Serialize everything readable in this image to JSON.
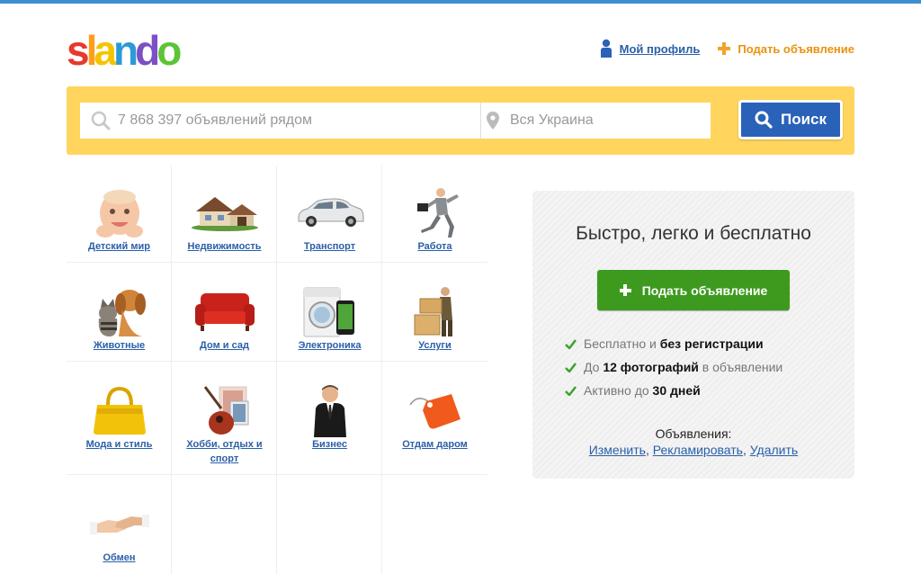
{
  "header": {
    "logo": {
      "letters": [
        "s",
        "l",
        "a",
        "n",
        "d",
        "o"
      ],
      "colors": [
        "#e6392f",
        "#ff9e1b",
        "#f5c400",
        "#2b9bd6",
        "#7d4fc4",
        "#5cc437"
      ]
    },
    "profile_label": "Мой профиль",
    "post_ad_label": "Подать объявление"
  },
  "search": {
    "query_placeholder": "7 868 397 объявлений рядом",
    "location_placeholder": "Вся Украина",
    "button_label": "Поиск"
  },
  "categories": [
    {
      "label": "Детский мир",
      "icon": "baby-icon"
    },
    {
      "label": "Недвижимость",
      "icon": "house-icon"
    },
    {
      "label": "Транспорт",
      "icon": "car-icon"
    },
    {
      "label": "Работа",
      "icon": "businessman-running-icon"
    },
    {
      "label": "Животные",
      "icon": "cat-dog-icon"
    },
    {
      "label": "Дом и сад",
      "icon": "sofa-icon"
    },
    {
      "label": "Электроника",
      "icon": "washer-phone-icon"
    },
    {
      "label": "Услуги",
      "icon": "mover-boxes-icon"
    },
    {
      "label": "Мода и стиль",
      "icon": "handbag-icon"
    },
    {
      "label": "Хобби, отдых и спорт",
      "icon": "guitar-icon"
    },
    {
      "label": "Бизнес",
      "icon": "businessman-icon"
    },
    {
      "label": "Отдам даром",
      "icon": "price-tag-icon"
    },
    {
      "label": "Обмен",
      "icon": "handshake-icon"
    }
  ],
  "promo": {
    "title": "Быстро, легко и бесплатно",
    "button_label": "Подать объявление",
    "features": [
      {
        "pre": "Бесплатно и ",
        "bold": "без регистрации",
        "post": ""
      },
      {
        "pre": "До ",
        "bold": "12 фотографий",
        "post": " в объявлении"
      },
      {
        "pre": "Активно до ",
        "bold": "30 дней",
        "post": ""
      }
    ],
    "ads_title": "Объявления:",
    "ads_links": [
      "Изменить",
      "Рекламировать",
      "Удалить"
    ]
  },
  "colors": {
    "accent_blue": "#2a62b9",
    "search_bg": "#ffd55e",
    "green": "#3e9a1f",
    "orange": "#e8920f",
    "top_bar": "#3d8fd1"
  }
}
